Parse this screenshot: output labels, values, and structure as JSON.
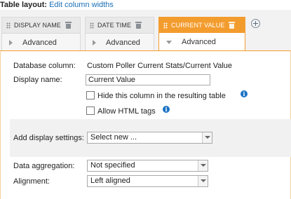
{
  "header": {
    "label": "Table layout:",
    "link": "Edit column widths"
  },
  "columns": [
    {
      "title": "DISPLAY NAME",
      "section": "Advanced",
      "active": false
    },
    {
      "title": "DATE TIME",
      "section": "Advanced",
      "active": false
    },
    {
      "title": "CURRENT VALUE",
      "section": "Advanced",
      "active": true
    }
  ],
  "panel": {
    "database_column": {
      "label": "Database column:",
      "value": "Custom Poller Current Stats/Current Value"
    },
    "display_name": {
      "label": "Display name:",
      "value": "Current Value"
    },
    "hide_column": {
      "label": "Hide this column in the resulting table",
      "checked": false
    },
    "allow_html": {
      "label": "Allow HTML tags",
      "checked": false
    },
    "display_settings": {
      "label": "Add display settings:",
      "selected": "Select new ..."
    },
    "data_aggregation": {
      "label": "Data aggregation:",
      "selected": "Not specified"
    },
    "alignment": {
      "label": "Alignment:",
      "selected": "Left aligned"
    }
  },
  "colors": {
    "accent": "#f39c2e",
    "link": "#1a6fb5",
    "info": "#1a72c4"
  },
  "icons": {
    "grip": "drag-handle-icon",
    "trash": "trash-icon",
    "add": "add-circle-icon",
    "info": "info-icon",
    "expand": "chevron-right-icon",
    "collapse": "chevron-down-icon"
  }
}
